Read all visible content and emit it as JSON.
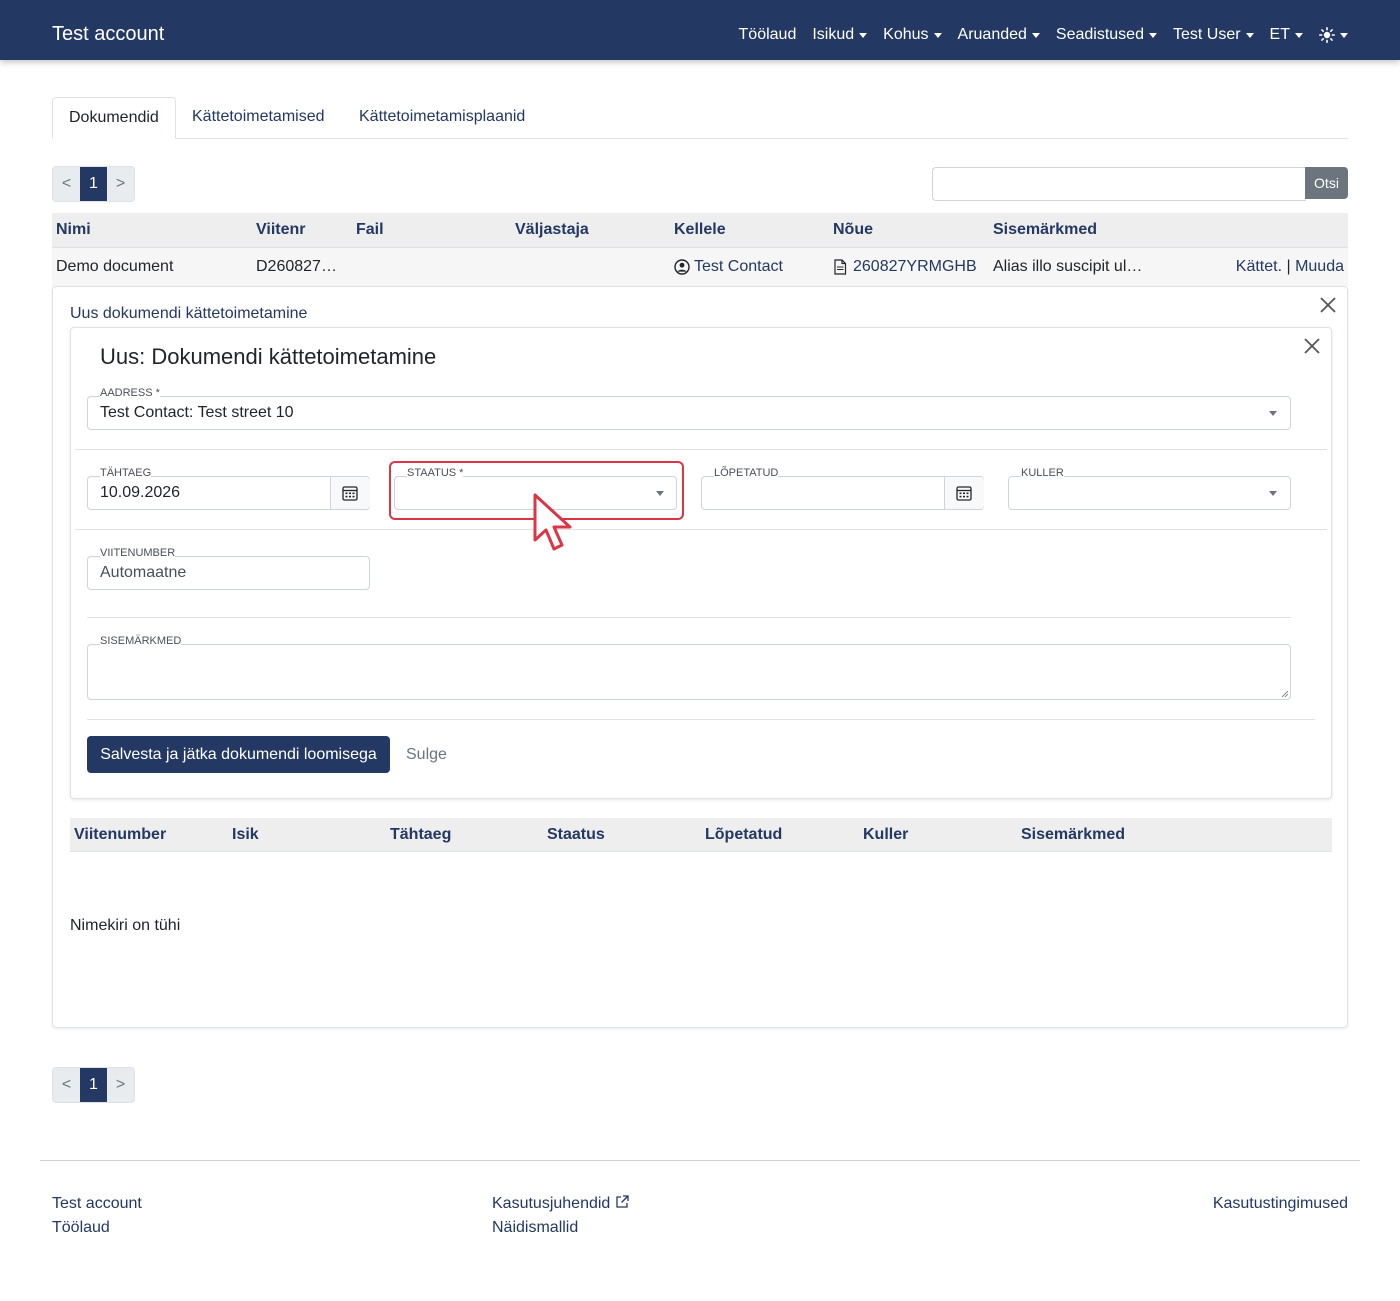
{
  "navbar": {
    "brand": "Test account",
    "items": [
      {
        "label": "Töölaud",
        "dropdown": false
      },
      {
        "label": "Isikud",
        "dropdown": true
      },
      {
        "label": "Kohus",
        "dropdown": true
      },
      {
        "label": "Aruanded",
        "dropdown": true
      },
      {
        "label": "Seadistused",
        "dropdown": true
      },
      {
        "label": "Test User",
        "dropdown": true
      },
      {
        "label": "ET",
        "dropdown": true
      }
    ],
    "theme_icon": "sun-icon"
  },
  "tabs": [
    "Dokumendid",
    "Kättetoimetamised",
    "Kättetoimetamisplaanid"
  ],
  "pagination": {
    "prev": "<",
    "page": "1",
    "next": ">"
  },
  "search": {
    "value": "",
    "button": "Otsi"
  },
  "table": {
    "headers": [
      "Nimi",
      "Viitenr",
      "Fail",
      "Väljastaja",
      "Kellele",
      "Nõue",
      "Sisemärkmed"
    ],
    "row": {
      "name": "Demo document",
      "ref": "D260827…",
      "file": "",
      "issuer": "",
      "recipient": "Test Contact",
      "claim": "260827YRMGHB",
      "notes": "Alias illo suscipit ul…",
      "action_deliver": "Kättet.",
      "action_sep": "|",
      "action_edit": "Muuda"
    }
  },
  "panel": {
    "title": "Uus dokumendi kättetoimetamine",
    "form": {
      "title": "Uus: Dokumendi kättetoimetamine",
      "address": {
        "label": "AADRESS *",
        "value": "Test Contact: Test street 10"
      },
      "deadline": {
        "label": "TÄHTAEG",
        "value": "10.09.2026"
      },
      "status": {
        "label": "STAATUS *",
        "value": ""
      },
      "completed": {
        "label": "LÕPETATUD",
        "value": ""
      },
      "courier": {
        "label": "KULLER",
        "value": ""
      },
      "reference": {
        "label": "VIITENUMBER",
        "value": "Automaatne"
      },
      "notes": {
        "label": "SISEMÄRKMED",
        "value": ""
      },
      "save_button": "Salvesta ja jätka dokumendi loomisega",
      "close_button": "Sulge"
    },
    "sub_table": {
      "headers": [
        "Viitenumber",
        "Isik",
        "Tähtaeg",
        "Staatus",
        "Lõpetatud",
        "Kuller",
        "Sisemärkmed"
      ],
      "empty": "Nimekiri on tühi"
    }
  },
  "footer": {
    "col1": [
      "Test account",
      "Töölaud"
    ],
    "col2": [
      "Kasutusjuhendid",
      "Näidismallid"
    ],
    "col3": [
      "Kasutustingimused"
    ]
  },
  "colors": {
    "primary": "#233862",
    "highlight": "#dc3545",
    "secondary": "#6c757d"
  }
}
